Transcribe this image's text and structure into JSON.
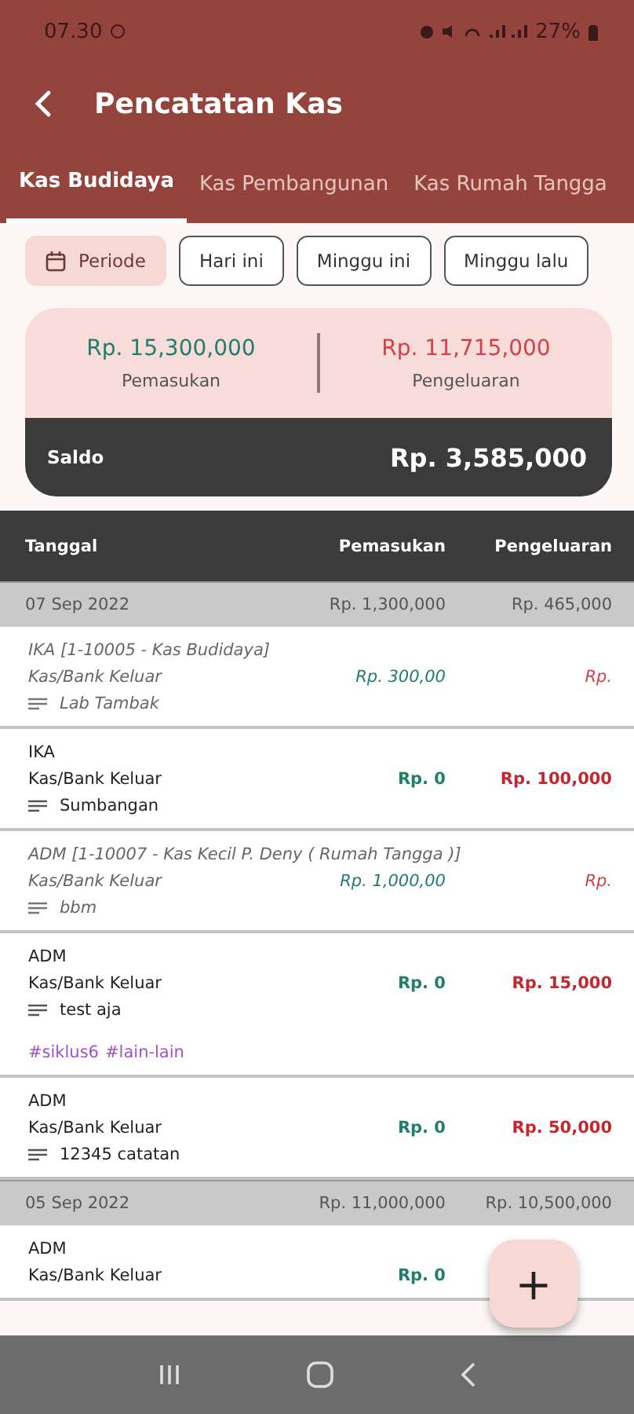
{
  "status_bar": {
    "time": "07.30",
    "battery": "27%"
  },
  "app_bar": {
    "title": "Pencatatan Kas"
  },
  "tabs": [
    {
      "label": "Kas Budidaya",
      "selected": true
    },
    {
      "label": "Kas Pembangunan",
      "selected": false
    },
    {
      "label": "Kas Rumah Tangga",
      "selected": false
    }
  ],
  "filters": [
    {
      "label": "Periode",
      "kind": "calendar",
      "selected": true
    },
    {
      "label": "Hari ini",
      "kind": "plain",
      "selected": false
    },
    {
      "label": "Minggu ini",
      "kind": "plain",
      "selected": false
    },
    {
      "label": "Minggu lalu",
      "kind": "plain",
      "selected": false
    }
  ],
  "summary": {
    "income": "Rp. 15,300,000",
    "income_label": "Pemasukan",
    "expense": "Rp. 11,715,000",
    "expense_label": "Pengeluaran",
    "balance_label": "Saldo",
    "balance": "Rp. 3,585,000"
  },
  "table": {
    "columns": [
      "Tanggal",
      "Pemasukan",
      "Pengeluaran"
    ],
    "groups": [
      {
        "date": "07 Sep 2022",
        "income": "Rp. 1,300,000",
        "expense": "Rp. 465,000",
        "entries": [
          {
            "kind": "transfer",
            "title": "IKA [1-10005 - Kas Budidaya]",
            "type": "Kas/Bank Keluar",
            "income": "Rp. 300,00",
            "expense": "Rp.",
            "note": "Lab Tambak"
          },
          {
            "kind": "normal",
            "title": "IKA",
            "type": "Kas/Bank Keluar",
            "income": "Rp. 0",
            "expense": "Rp. 100,000",
            "note": "Sumbangan"
          },
          {
            "kind": "transfer",
            "title": "ADM [1-10007 - Kas Kecil P. Deny ( Rumah Tangga )]",
            "type": "Kas/Bank Keluar",
            "income": "Rp. 1,000,00",
            "expense": "Rp.",
            "note": "bbm"
          },
          {
            "kind": "normal",
            "title": "ADM",
            "type": "Kas/Bank Keluar",
            "income": "Rp. 0",
            "expense": "Rp. 15,000",
            "note": "test aja",
            "tags": [
              "#siklus6",
              "#lain-lain"
            ]
          },
          {
            "kind": "normal",
            "title": "ADM",
            "type": "Kas/Bank Keluar",
            "income": "Rp. 0",
            "expense": "Rp. 50,000",
            "note": "12345 catatan"
          }
        ]
      },
      {
        "date": "05 Sep 2022",
        "income": "Rp. 11,000,000",
        "expense": "Rp. 10,500,000",
        "entries": [
          {
            "kind": "normal",
            "title": "ADM",
            "type": "Kas/Bank Keluar",
            "income": "Rp. 0"
          }
        ]
      }
    ]
  },
  "fab": {
    "label": "+"
  }
}
